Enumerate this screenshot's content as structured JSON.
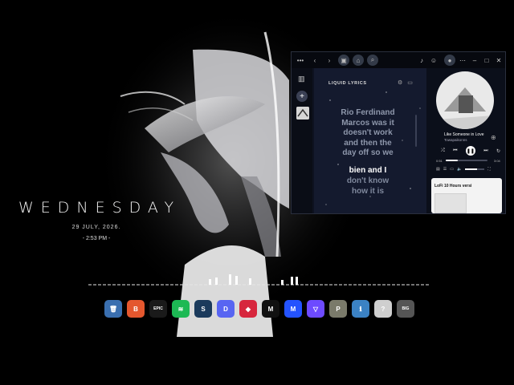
{
  "desktop": {
    "day": "WEDNESDAY",
    "date": "29  JULY, 2026.",
    "time": "- 2:53 PM -"
  },
  "dock": {
    "icons": [
      {
        "name": "recycle-bin-icon",
        "glyph": "🗑",
        "color": "#3a6fb0"
      },
      {
        "name": "brave-icon",
        "glyph": "B",
        "color": "#e4572e"
      },
      {
        "name": "epic-games-icon",
        "glyph": "EPIC",
        "color": "#1a1a1a"
      },
      {
        "name": "spotify-icon",
        "glyph": "≋",
        "color": "#1db954"
      },
      {
        "name": "steam-icon",
        "glyph": "S",
        "color": "#1b3a5c"
      },
      {
        "name": "discord-icon",
        "glyph": "D",
        "color": "#5865f2"
      },
      {
        "name": "epic-launcher-icon",
        "glyph": "◆",
        "color": "#d7263d"
      },
      {
        "name": "mega-icon",
        "glyph": "M",
        "color": "#111111"
      },
      {
        "name": "malwarebytes-icon",
        "glyph": "M",
        "color": "#2453ff"
      },
      {
        "name": "proton-vpn-icon",
        "glyph": "▽",
        "color": "#6d4aff"
      },
      {
        "name": "pubg-icon",
        "glyph": "P",
        "color": "#7a7a6a"
      },
      {
        "name": "file-browser-icon",
        "glyph": "ℹ",
        "color": "#3b82c4"
      },
      {
        "name": "help-icon",
        "glyph": "?",
        "color": "#cfcfcf"
      },
      {
        "name": "game-launcher-icon",
        "glyph": "BIG",
        "color": "#555555"
      }
    ]
  },
  "spotify": {
    "lyrics_title": "LIQUID LYRICS",
    "lyrics_past": [
      "Rio Ferdinand",
      "Marcos was it",
      "doesn't work",
      "and then the",
      "day off so we"
    ],
    "lyrics_current": "bien and I",
    "lyrics_next": [
      "don't know",
      "how it is"
    ],
    "track_title": "Like Someone in Love",
    "artist": "Towapaikonns",
    "time_elapsed": "0:51",
    "time_total": "3:04",
    "progress": 0.28,
    "volume": 0.6,
    "card_title": "LoFi 10 Hours versi"
  }
}
